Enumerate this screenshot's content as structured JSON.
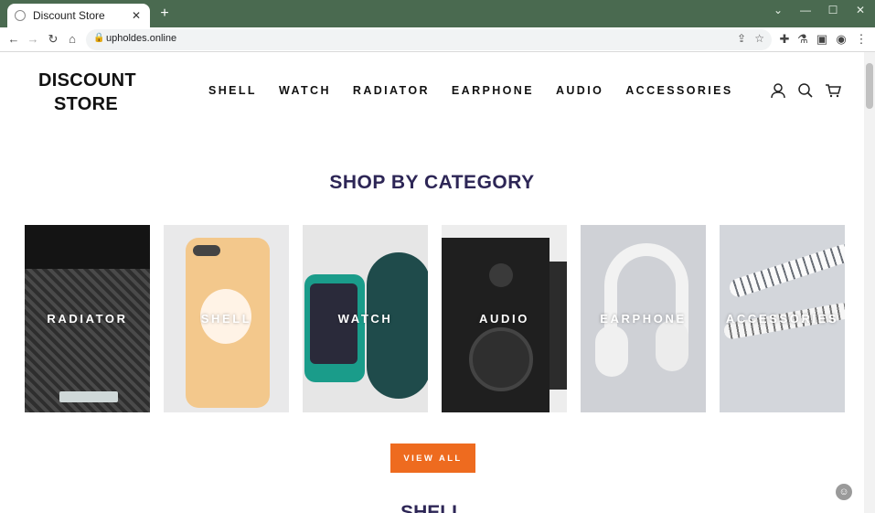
{
  "browser": {
    "tab_title": "Discount Store",
    "tab_close": "✕",
    "new_tab": "+",
    "url": "upholdes.online",
    "window_controls": [
      "⌄",
      "—",
      "☐",
      "✕"
    ]
  },
  "store": {
    "logo_line1": "DISCOUNT",
    "logo_line2": "STORE",
    "nav": [
      "SHELL",
      "WATCH",
      "RADIATOR",
      "EARPHONE",
      "AUDIO",
      "ACCESSORIES"
    ]
  },
  "section": {
    "title": "SHOP BY CATEGORY",
    "view_all": "VIEW ALL",
    "next_title": "SHELL"
  },
  "categories": [
    {
      "label": "RADIATOR"
    },
    {
      "label": "SHELL"
    },
    {
      "label": "WATCH"
    },
    {
      "label": "AUDIO"
    },
    {
      "label": "EARPHONE"
    },
    {
      "label": "ACCESSORIES"
    }
  ],
  "colors": {
    "accent": "#ee6b1f",
    "heading": "#2d2656",
    "chrome": "#4a6a50"
  }
}
